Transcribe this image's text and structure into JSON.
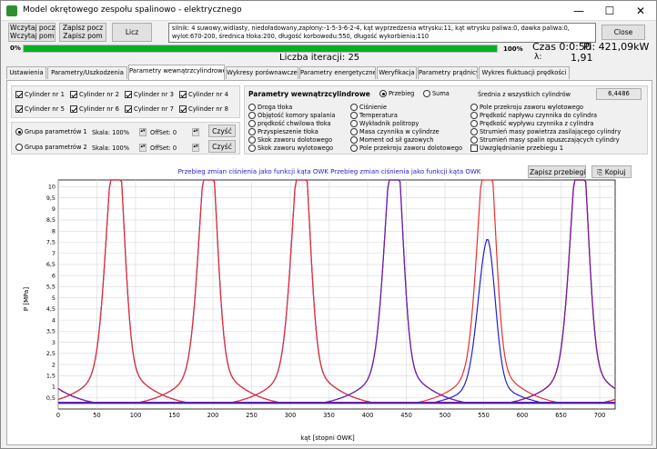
{
  "window": {
    "title": "Model okrętowego zespołu spalinowo - elektrycznego",
    "minimize": "—",
    "maximize": "☐",
    "close": "✕"
  },
  "toolbar": {
    "read_btn": [
      "Wczytaj pocz",
      "Wczytaj pom"
    ],
    "save_btn": [
      "Zapisz pocz",
      "Zapisz pom"
    ],
    "calc_btn": "Licz",
    "close_btn": "Close"
  },
  "info": {
    "text": "silnik: 4 suwowy,widlasty, niedoładowany,zapłony:-1-5-3-6-2-4, kąt wyprzedzenia wtrysku:11, kąt wtrysku paliwa:0, dawka paliwa:0, wylot:670-200, średnica tłoka:200, długość korbowodu:550, długość wykorbienia:110"
  },
  "progress": {
    "left_label": "0%",
    "right_label": "100%",
    "fraction": 1.0
  },
  "status": {
    "iterations_label": "Liczba iteracji: 25",
    "time_label": "Czas 0:0:50",
    "power_label": "Pi: 421,09kW",
    "lambda_label": "λ:",
    "lambda_value": "1,91"
  },
  "tabs": [
    {
      "label": "Ustawienia",
      "active": false
    },
    {
      "label": "Parametry/Uszkodzenia",
      "active": false
    },
    {
      "label": "Parametry wewnątrzcylindrowe",
      "active": true
    },
    {
      "label": "Wykresy porównawcze",
      "active": false
    },
    {
      "label": "Parametry energetyczne",
      "active": false
    },
    {
      "label": "Weryfikacja",
      "active": false
    },
    {
      "label": "Parametry prądnicy",
      "active": false
    },
    {
      "label": "Wykres fluktuacji prędkości",
      "active": false
    }
  ],
  "cylinders": [
    {
      "label": "Cylinder nr 1",
      "checked": true
    },
    {
      "label": "Cylinder nr 2",
      "checked": true
    },
    {
      "label": "Cylinder nr 3",
      "checked": true
    },
    {
      "label": "Cylinder nr 4",
      "checked": true
    },
    {
      "label": "Cylinder nr 5",
      "checked": true
    },
    {
      "label": "Cylinder nr 6",
      "checked": true
    },
    {
      "label": "Cylinder nr 7",
      "checked": true
    },
    {
      "label": "Cylinder nr 8",
      "checked": true
    }
  ],
  "groups": [
    {
      "label": "Grupa parametrów 1",
      "selected": true,
      "scale": "Skala: 100%",
      "offset": "OffSet: 0",
      "clear": "Czyść"
    },
    {
      "label": "Grupa parametrów 2",
      "selected": false,
      "scale": "Skala: 100%",
      "offset": "OffSet: 0",
      "clear": "Czyść"
    }
  ],
  "params_header": "Parametry wewnątrzcylindrowe",
  "mode": {
    "przebieg": "Przebieg",
    "suma": "Suma",
    "avg_label": "Średnia z wszystkich cylindrów",
    "avg_value": "6,4486"
  },
  "param_cols": [
    [
      "Droga tłoka",
      "Objętość komory spalania",
      "prędkość chwilowa tłoka",
      "Przyspieszenie tłoka",
      "Skok zaworu dolotowego",
      "Skok zaworu wylotowego"
    ],
    [
      "Ciśnienie",
      "Temperatura",
      "Wykładnik politropy",
      "Masa czynnika w cylindrze",
      "Moment od sił gazowych",
      "Pole przekroju zaworu dolotowego"
    ],
    [
      "Pole przekroju zaworu wylotowego",
      "Prędkość napływu czynnika do cylindra",
      "Prędkość wypływu czynnika z cylindra",
      "Strumień masy powietrza zasilającego cylindry",
      "Strumień masy spalin opuszczających cylindry",
      "Uwzględnianie przebiegu 1"
    ]
  ],
  "chart_buttons": {
    "save": "Zapisz przebiegi",
    "copy": "Kopiuj"
  },
  "chart_data": {
    "type": "line",
    "title": "Przebieg zmian ciśnienia jako funkcji kąta OWK   Przebieg zmian ciśnienia jako funkcji kąta OWK",
    "xlabel": "kąt [stopni OWK]",
    "ylabel": "P [MPa]",
    "xlim": [
      0,
      720
    ],
    "ylim": [
      0,
      10.3
    ],
    "x_ticks": [
      0,
      50,
      100,
      150,
      200,
      250,
      300,
      350,
      400,
      450,
      500,
      550,
      600,
      650,
      700
    ],
    "y_ticks": [
      0.5,
      1,
      1.5,
      2,
      2.5,
      3,
      3.5,
      4,
      4.5,
      5,
      5.5,
      6,
      6.5,
      7,
      7.5,
      8,
      8.5,
      9,
      9.5,
      10
    ],
    "grid": true,
    "peak_height": 10.1,
    "peak_width_deg": 12,
    "base_pressure": 0.3,
    "series": [
      {
        "color": "#2020d0",
        "peak_x": 75,
        "peak_y": 10.1
      },
      {
        "color": "#e83030",
        "peak_x": 75,
        "peak_y": 10.1
      },
      {
        "color": "#2020d0",
        "peak_x": 195,
        "peak_y": 10.1
      },
      {
        "color": "#e83030",
        "peak_x": 195,
        "peak_y": 10.1
      },
      {
        "color": "#2020d0",
        "peak_x": 315,
        "peak_y": 10.1
      },
      {
        "color": "#e83030",
        "peak_x": 315,
        "peak_y": 10.1
      },
      {
        "color": "#2020d0",
        "peak_x": 435,
        "peak_y": 10.1
      },
      {
        "color": "#e83030",
        "peak_x": 555,
        "peak_y": 10.1
      },
      {
        "color": "#2020d0",
        "peak_x": 555,
        "peak_y": 6.0
      },
      {
        "color": "#2020d0",
        "peak_x": 675,
        "peak_y": 10.1
      },
      {
        "color": "#e83030",
        "peak_x": 675,
        "peak_y": 10.1
      },
      {
        "color": "#7020a0",
        "peak_x": 435,
        "peak_y": 10.1
      },
      {
        "color": "#7020a0",
        "peak_x": -45,
        "peak_y": 10.1
      }
    ]
  }
}
